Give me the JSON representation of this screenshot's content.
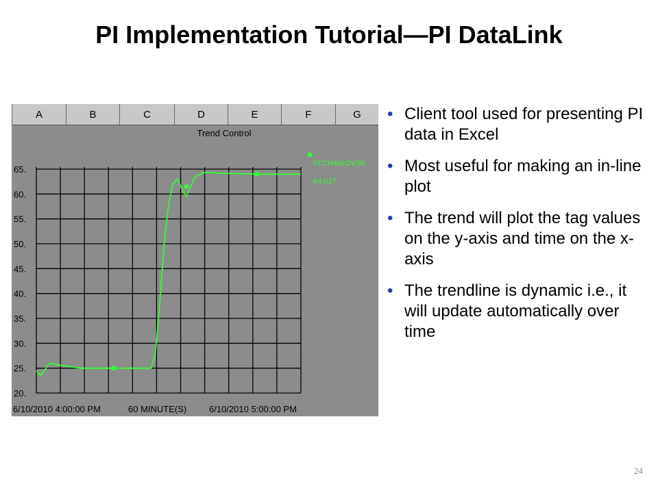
{
  "slide": {
    "title": "PI Implementation Tutorial—PI DataLink",
    "page_number": "24",
    "bullets": [
      "Client tool used for presenting PI data in Excel",
      "Most useful for making an in-line plot",
      "The trend will plot the tag values on the y-axis and time on the x-axis",
      "The trendline is dynamic i.e., it will update automatically over time"
    ]
  },
  "spreadsheet": {
    "columns": [
      "A",
      "B",
      "C",
      "D",
      "E",
      "F",
      "G"
    ]
  },
  "trend": {
    "title": "Trend Control",
    "tag_label": "\\\\TCHAIKOVSK",
    "current_value": "64.017",
    "y_ticks": [
      "65.",
      "60.",
      "55.",
      "50.",
      "45.",
      "40.",
      "35.",
      "30.",
      "25.",
      "20."
    ],
    "x_labels": {
      "start": "6/10/2010 4:00:00 PM",
      "span": "60 MINUTE(S)",
      "end": "6/10/2010 5:00:00 PM"
    },
    "colors": {
      "plot_background": "#8c8c8c",
      "grid": "#000000",
      "trace": "#33ff33"
    }
  },
  "chart_data": {
    "type": "line",
    "title": "Trend Control",
    "xlabel": "",
    "ylabel": "",
    "x_range": [
      "6/10/2010 4:00:00 PM",
      "6/10/2010 5:00:00 PM"
    ],
    "ylim": [
      20,
      65
    ],
    "grid": true,
    "legend_position": "top-right",
    "series": [
      {
        "name": "\\\\TCHAIKOVSK",
        "x_minutes": [
          0,
          1,
          3,
          6,
          10,
          14,
          18,
          20,
          23,
          26,
          27,
          28,
          29,
          30,
          31,
          32,
          33,
          34,
          36,
          38,
          39,
          40,
          41,
          45,
          50,
          55,
          60
        ],
        "values": [
          24.5,
          23.5,
          26,
          25.5,
          25,
          25,
          25,
          25,
          25,
          25,
          28,
          38,
          50,
          58,
          62,
          63,
          61,
          59.5,
          63.5,
          64.3,
          64.3,
          64.3,
          64.2,
          64.1,
          64,
          64,
          64
        ]
      }
    ]
  }
}
